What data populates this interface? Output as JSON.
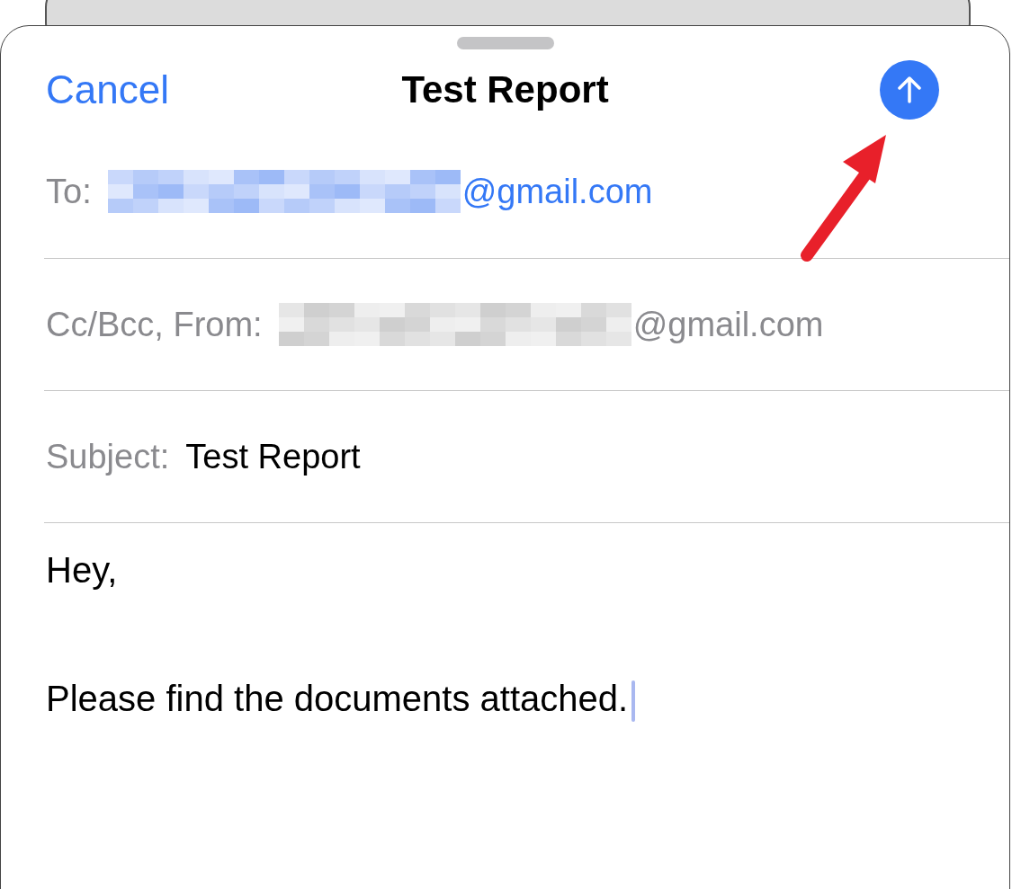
{
  "header": {
    "cancel": "Cancel",
    "title": "Test Report"
  },
  "fields": [
    {
      "label": "To:",
      "value_suffix": "@gmail.com",
      "kind": "recipient"
    },
    {
      "label": "Cc/Bcc, From:",
      "value_suffix": "@gmail.com",
      "kind": "sender"
    },
    {
      "label": "Subject:",
      "value": "Test Report",
      "kind": "text"
    }
  ],
  "body": [
    "Hey,",
    "Please find the documents attached."
  ]
}
